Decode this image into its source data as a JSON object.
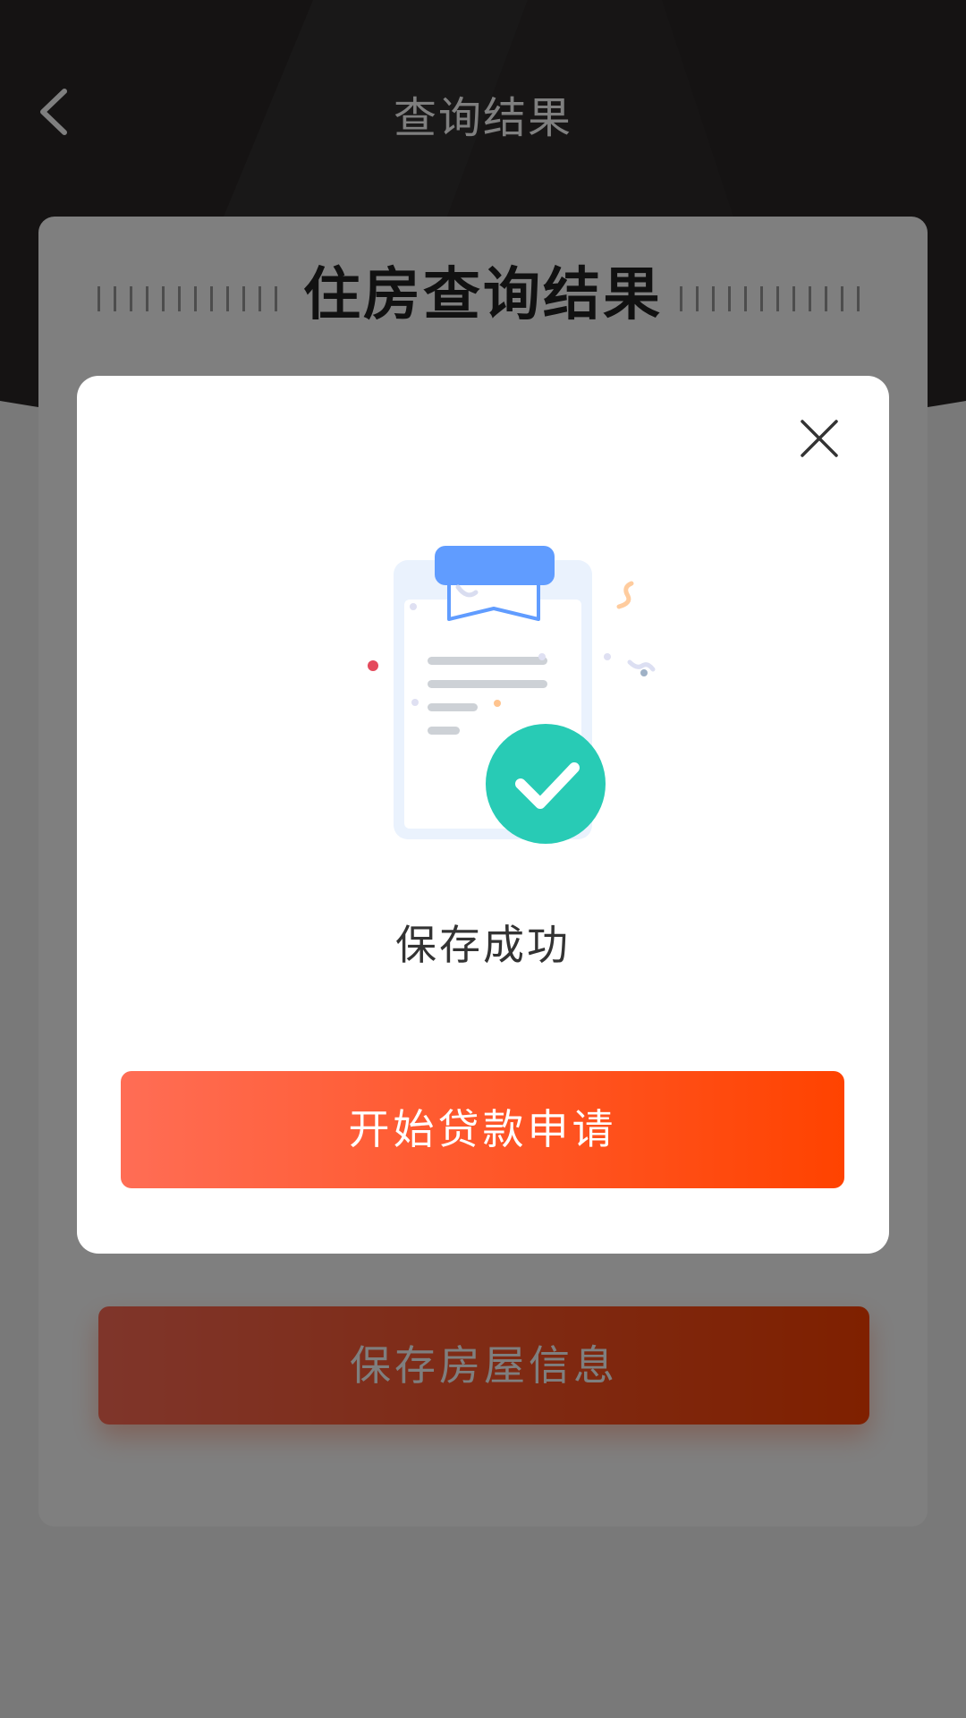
{
  "header": {
    "title": "查询结果",
    "back_icon": "chevron-left-icon"
  },
  "card": {
    "title": "住房查询结果",
    "save_button_label": "保存房屋信息"
  },
  "modal": {
    "close_icon": "close-icon",
    "illustration_icon": "clipboard-success-icon",
    "message": "保存成功",
    "primary_button_label": "开始贷款申请"
  },
  "colors": {
    "header_bg": "#2a2626",
    "button_gradient_start": "#ff6d55",
    "button_gradient_end": "#ff4300",
    "success_green": "#28cbb5",
    "clipboard_blue": "#609cff"
  }
}
